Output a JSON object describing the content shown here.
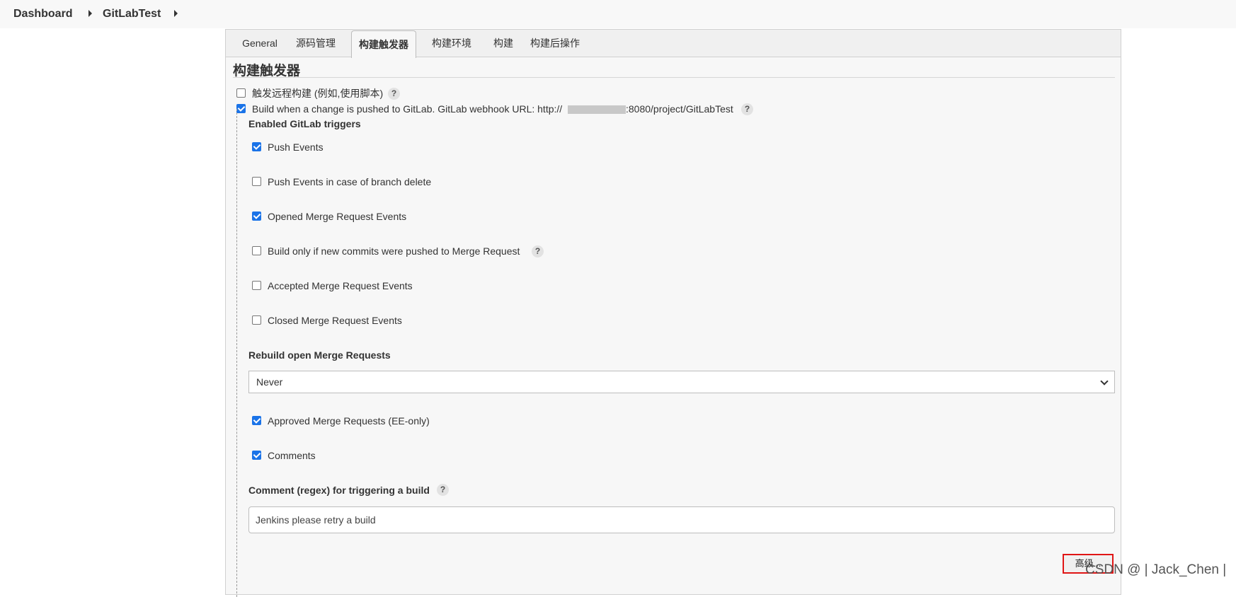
{
  "breadcrumb": {
    "dashboard": "Dashboard",
    "project": "GitLabTest"
  },
  "tabs": [
    "General",
    "源码管理",
    "构建触发器",
    "构建环境",
    "构建",
    "构建后操作"
  ],
  "section": {
    "title": "构建触发器"
  },
  "remote_trigger": {
    "label": "触发远程构建 (例如,使用脚本)",
    "checked": false
  },
  "gitlab_trigger": {
    "label_prefix": "Build when a change is pushed to GitLab. GitLab webhook URL: http://",
    "label_suffix": ":8080/project/GitLabTest",
    "checked": true
  },
  "enabled_triggers_heading": "Enabled GitLab triggers",
  "triggers": [
    {
      "label": "Push Events",
      "checked": true
    },
    {
      "label": "Push Events in case of branch delete",
      "checked": false
    },
    {
      "label": "Opened Merge Request Events",
      "checked": true
    },
    {
      "label": "Build only if new commits were pushed to Merge Request",
      "checked": false
    },
    {
      "label": "Accepted Merge Request Events",
      "checked": false
    },
    {
      "label": "Closed Merge Request Events",
      "checked": false
    }
  ],
  "rebuild": {
    "heading": "Rebuild open Merge Requests",
    "selected": "Never"
  },
  "approved": {
    "label": "Approved Merge Requests (EE-only)",
    "checked": true
  },
  "comments": {
    "label": "Comments",
    "checked": true
  },
  "comment_regex": {
    "heading": "Comment (regex) for triggering a build",
    "value": "Jenkins please retry a build"
  },
  "advanced_button": "高级...",
  "watermark": "CSDN @ | Jack_Chen |",
  "help_glyph": "?",
  "colors": {
    "checkbox_checked": "#1a73e8",
    "highlight_box": "#e01515"
  }
}
